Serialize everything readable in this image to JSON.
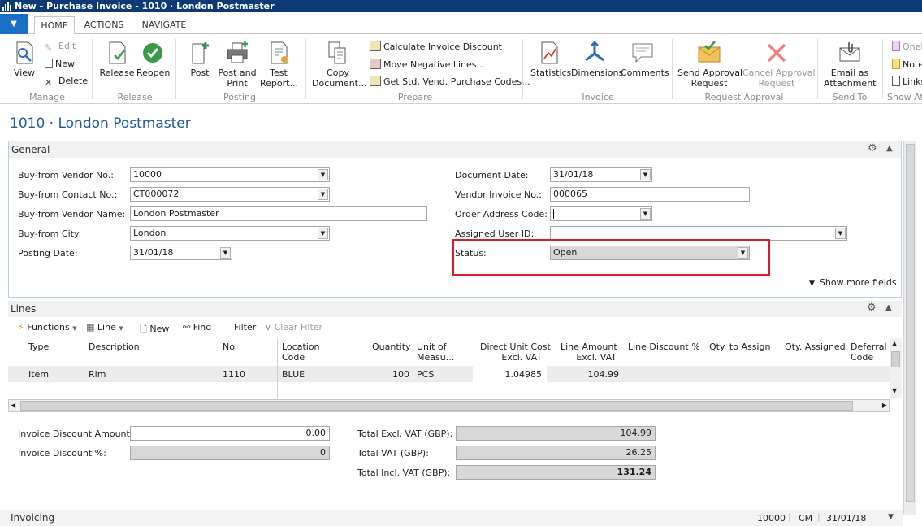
{
  "window": {
    "title": "New - Purchase Invoice - 1010 · London Postmaster"
  },
  "tabs": [
    "HOME",
    "ACTIONS",
    "NAVIGATE"
  ],
  "ribbon": {
    "manage": {
      "view": "View",
      "edit": "Edit",
      "new": "New",
      "delete": "Delete",
      "label": "Manage"
    },
    "release": {
      "release": "Release",
      "reopen": "Reopen",
      "label": "Release"
    },
    "posting": {
      "post": "Post",
      "post_print_1": "Post and",
      "post_print_2": "Print",
      "test_1": "Test",
      "test_2": "Report...",
      "label": "Posting"
    },
    "prepare": {
      "copy_1": "Copy",
      "copy_2": "Document...",
      "calc": "Calculate Invoice Discount",
      "move": "Move Negative Lines...",
      "getstd": "Get Std. Vend. Purchase Codes...",
      "label": "Prepare"
    },
    "invoice": {
      "statistics": "Statistics",
      "dimensions": "Dimensions",
      "comments": "Comments",
      "label": "Invoice"
    },
    "approval": {
      "send_1": "Send Approval",
      "send_2": "Request",
      "cancel_1": "Cancel Approval",
      "cancel_2": "Request",
      "label": "Request Approval"
    },
    "sendto": {
      "email_1": "Email as",
      "email_2": "Attachment",
      "label": "Send To"
    },
    "showatt": {
      "onenote": "OneN",
      "notes": "Note",
      "links": "Links",
      "label": "Show Att"
    }
  },
  "page_title": "1010 · London Postmaster",
  "general": {
    "header": "General",
    "buy_from_vendor_no": {
      "label": "Buy-from Vendor No.:",
      "value": "10000"
    },
    "buy_from_contact_no": {
      "label": "Buy-from Contact No.:",
      "value": "CT000072"
    },
    "buy_from_vendor_name": {
      "label": "Buy-from Vendor Name:",
      "value": "London Postmaster"
    },
    "buy_from_city": {
      "label": "Buy-from City:",
      "value": "London"
    },
    "posting_date": {
      "label": "Posting Date:",
      "value": "31/01/18"
    },
    "document_date": {
      "label": "Document Date:",
      "value": "31/01/18"
    },
    "vendor_invoice_no": {
      "label": "Vendor Invoice No.:",
      "value": "000065"
    },
    "order_address_code": {
      "label": "Order Address Code:",
      "value": ""
    },
    "assigned_user_id": {
      "label": "Assigned User ID:",
      "value": ""
    },
    "status": {
      "label": "Status:",
      "value": "Open"
    },
    "show_more": "Show more fields"
  },
  "lines": {
    "header": "Lines",
    "toolbar": {
      "functions": "Functions",
      "line": "Line",
      "new": "New",
      "find": "Find",
      "filter": "Filter",
      "clear_filter": "Clear Filter"
    },
    "columns": {
      "type": "Type",
      "description": "Description",
      "no": "No.",
      "location_1": "Location",
      "location_2": "Code",
      "quantity": "Quantity",
      "uom_1": "Unit of",
      "uom_2": "Measu...",
      "dcost_1": "Direct Unit Cost",
      "dcost_2": "Excl. VAT",
      "lamt_1": "Line Amount",
      "lamt_2": "Excl. VAT",
      "ldisc": "Line Discount %",
      "qta": "Qty. to Assign",
      "qa": "Qty. Assigned",
      "defer_1": "Deferral",
      "defer_2": "Code"
    },
    "row": {
      "type": "Item",
      "description": "Rim",
      "no": "1110",
      "location": "BLUE",
      "quantity": "100",
      "uom": "PCS",
      "direct_unit_cost": "1.04985",
      "line_amount": "104.99"
    }
  },
  "totals": {
    "inv_disc_amount": {
      "label": "Invoice Discount Amount:",
      "value": "0.00"
    },
    "inv_disc_pct": {
      "label": "Invoice Discount %:",
      "value": "0"
    },
    "total_excl": {
      "label": "Total Excl. VAT (GBP):",
      "value": "104.99"
    },
    "total_vat": {
      "label": "Total VAT (GBP):",
      "value": "26.25"
    },
    "total_incl": {
      "label": "Total Incl. VAT (GBP):",
      "value": "131.24"
    }
  },
  "invoicing": {
    "header": "Invoicing",
    "vendor": "10000",
    "code": "CM",
    "date": "31/01/18"
  },
  "colors": {
    "titlebar": "#0b3a75",
    "accent": "#1d5aa3",
    "highlight_box": "#d81e2b"
  }
}
